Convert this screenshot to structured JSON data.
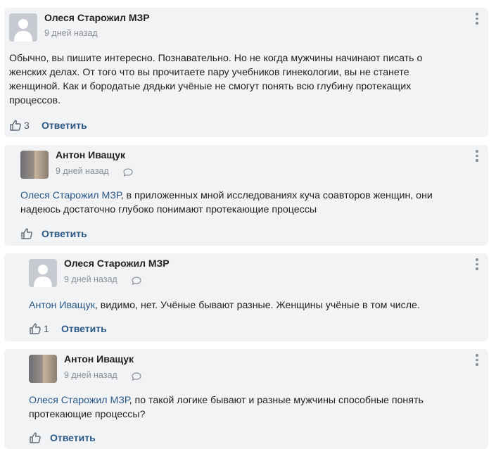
{
  "comments": [
    {
      "author": "Олеся Старожил МЗР",
      "time": "9 дней назад",
      "text": "Обычно, вы пишите интересно. Познавательно. Но не когда мужчины начинают писать о женских делах. От того что вы прочитаете пару учебников гинекологии, вы не станете женщиной. Как и бородатые дядьки учёные не смогут понять всю глубину протекащих процессов.",
      "likes": "3",
      "reply_label": "Ответить"
    },
    {
      "author": "Антон Иващук",
      "time": "9 дней назад",
      "mention": "Олеся Старожил МЗР",
      "text": ", в приложенных мной исследованиях куча соавторов женщин, они надеюсь достаточно глубоко понимают протекающие процессы",
      "likes": "",
      "reply_label": "Ответить"
    },
    {
      "author": "Олеся Старожил МЗР",
      "time": "9 дней назад",
      "mention": "Антон Иващук",
      "text": ", видимо, нет. Учёные бывают разные. Женщины учёные в том числе.",
      "likes": "1",
      "reply_label": "Ответить"
    },
    {
      "author": "Антон Иващук",
      "time": "9 дней назад",
      "mention": "Олеся Старожил МЗР",
      "text": ", по такой логике бывают и разные мужчины способные понять протекающие процессы?",
      "likes": "",
      "reply_label": "Ответить"
    }
  ],
  "icons": {
    "like": "thumbs-up-icon",
    "reply": "speech-bubble-icon",
    "more": "vertical-dots-icon"
  },
  "colors": {
    "card_bg": "#f2f3f5",
    "link": "#2a5885",
    "muted": "#8a8f96"
  }
}
